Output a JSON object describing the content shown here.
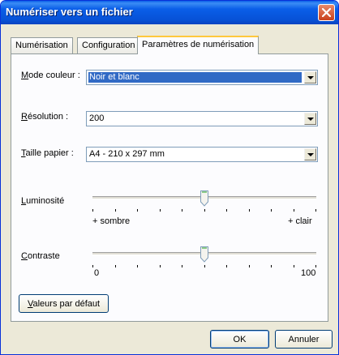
{
  "window": {
    "title": "Numériser vers un fichier"
  },
  "tabs": [
    "Numérisation",
    "Configuration",
    "Paramètres de numérisation"
  ],
  "fields": {
    "mode_label_u": "M",
    "mode_label": "ode couleur :",
    "mode_value": "Noir et blanc",
    "resolution_label_u": "R",
    "resolution_label": "ésolution :",
    "resolution_value": "200",
    "paper_label_u": "T",
    "paper_label": "aille papier :",
    "paper_value": "A4 - 210 x 297 mm"
  },
  "brightness": {
    "label_u": "L",
    "label": "uminosité",
    "min_label": "+ sombre",
    "max_label": "+ clair",
    "level": 0.5
  },
  "contrast": {
    "label_u": "C",
    "label": "ontraste",
    "min_label": "0",
    "max_label": "100",
    "level": 0.5
  },
  "buttons": {
    "defaults_u": "V",
    "defaults": "aleurs par défaut",
    "ok": "OK",
    "cancel": "Annuler"
  }
}
